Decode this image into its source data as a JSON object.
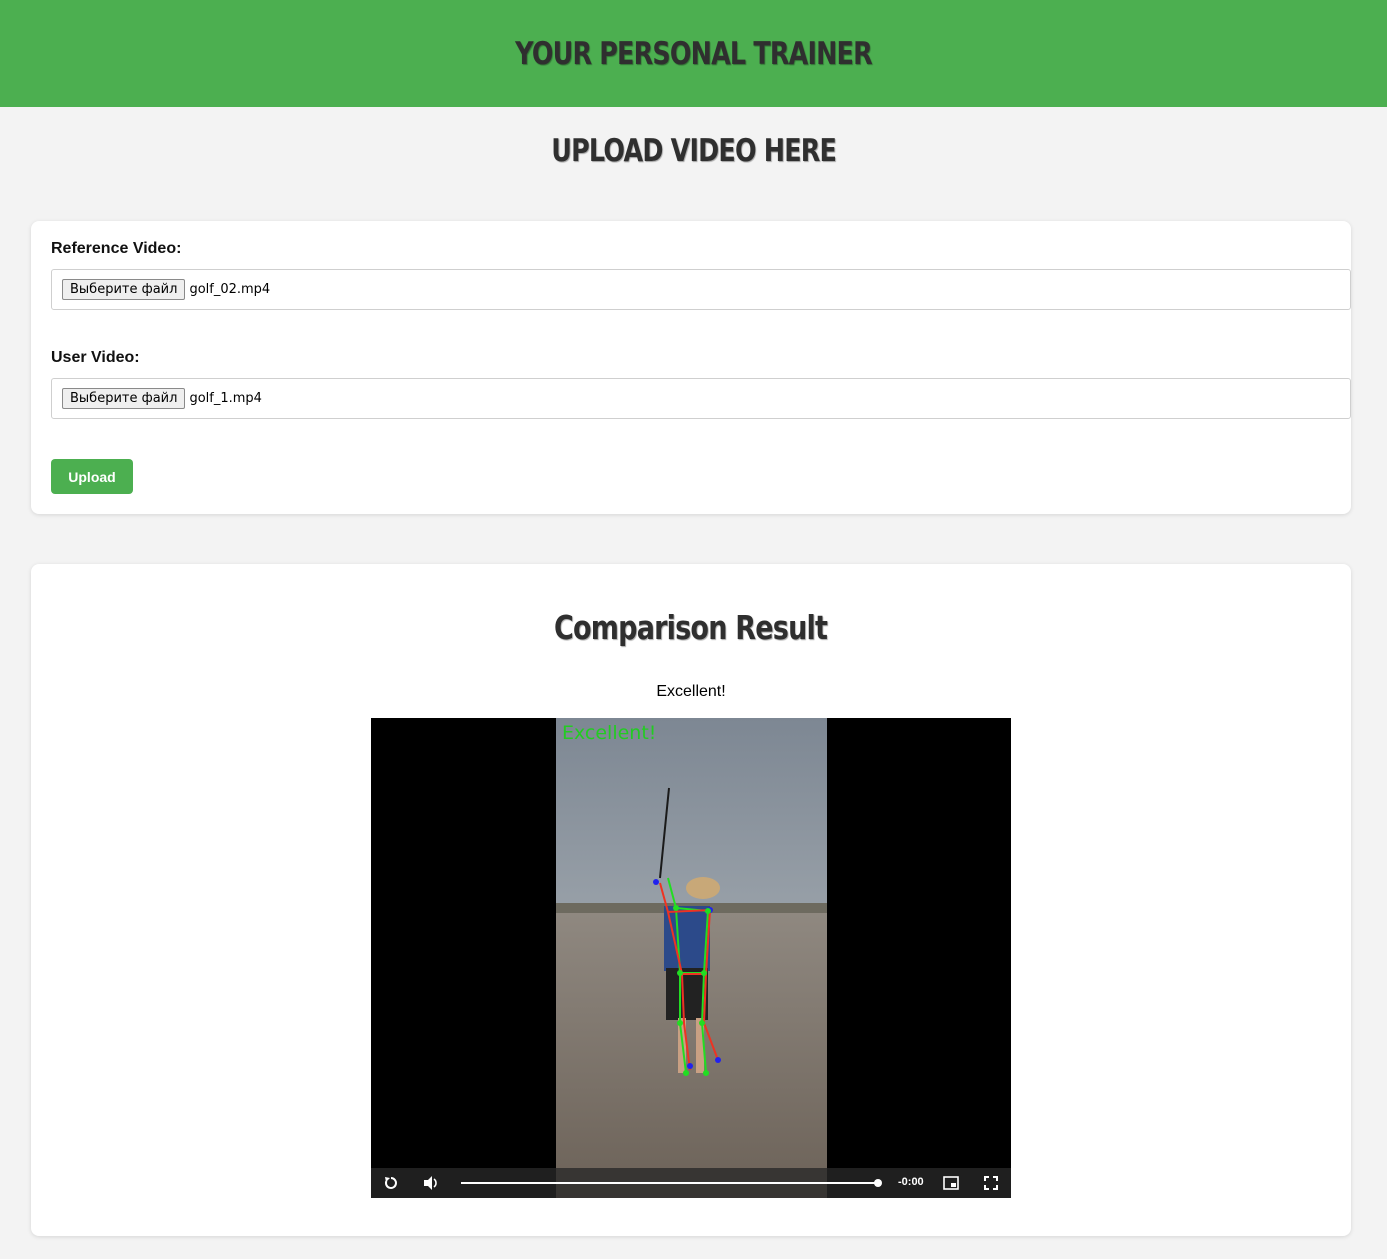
{
  "header": {
    "title": "YOUR PERSONAL TRAINER"
  },
  "page": {
    "title": "UPLOAD VIDEO HERE"
  },
  "upload_form": {
    "reference_label": "Reference Video:",
    "reference_button": "Выберите файл",
    "reference_file": "golf_02.mp4",
    "user_label": "User Video:",
    "user_button": "Выберите файл",
    "user_file": "golf_1.mp4",
    "submit_label": "Upload"
  },
  "result": {
    "title": "Comparison Result",
    "message": "Excellent!",
    "overlay_text": "Excellent!",
    "video": {
      "time_remaining": "-0:00",
      "progress": 1.0
    }
  },
  "colors": {
    "accent": "#4caf50",
    "background": "#f3f3f3",
    "skeleton_user": "#22dd22",
    "skeleton_reference": "#ee3322",
    "joint": "#2222ee"
  },
  "icons": [
    "replay-icon",
    "volume-icon",
    "picture-in-picture-icon",
    "fullscreen-icon"
  ]
}
